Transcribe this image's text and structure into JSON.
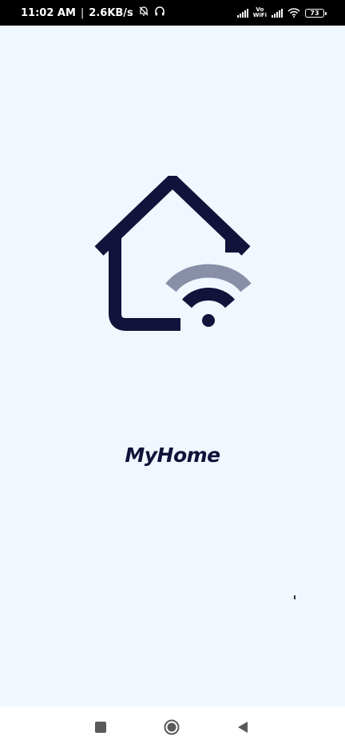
{
  "status_bar": {
    "time": "11:02 AM",
    "separator": "|",
    "network_speed": "2.6KB/s",
    "vowifi_top": "Vo",
    "vowifi_bottom": "WiFi",
    "battery_level": "73",
    "icons": [
      "mute-bell-icon",
      "headphones-icon",
      "signal-icon",
      "vowifi-icon",
      "signal-icon",
      "wifi-icon",
      "battery-icon"
    ]
  },
  "splash": {
    "app_name": "MyHome",
    "logo_icon": "home-wifi-logo-icon",
    "colors": {
      "background": "#f0f7ff",
      "primary": "#12123a",
      "wifi_outer": "#8a8fa8"
    }
  },
  "nav_bar": {
    "buttons": [
      "recents-button",
      "home-button",
      "back-button"
    ]
  }
}
